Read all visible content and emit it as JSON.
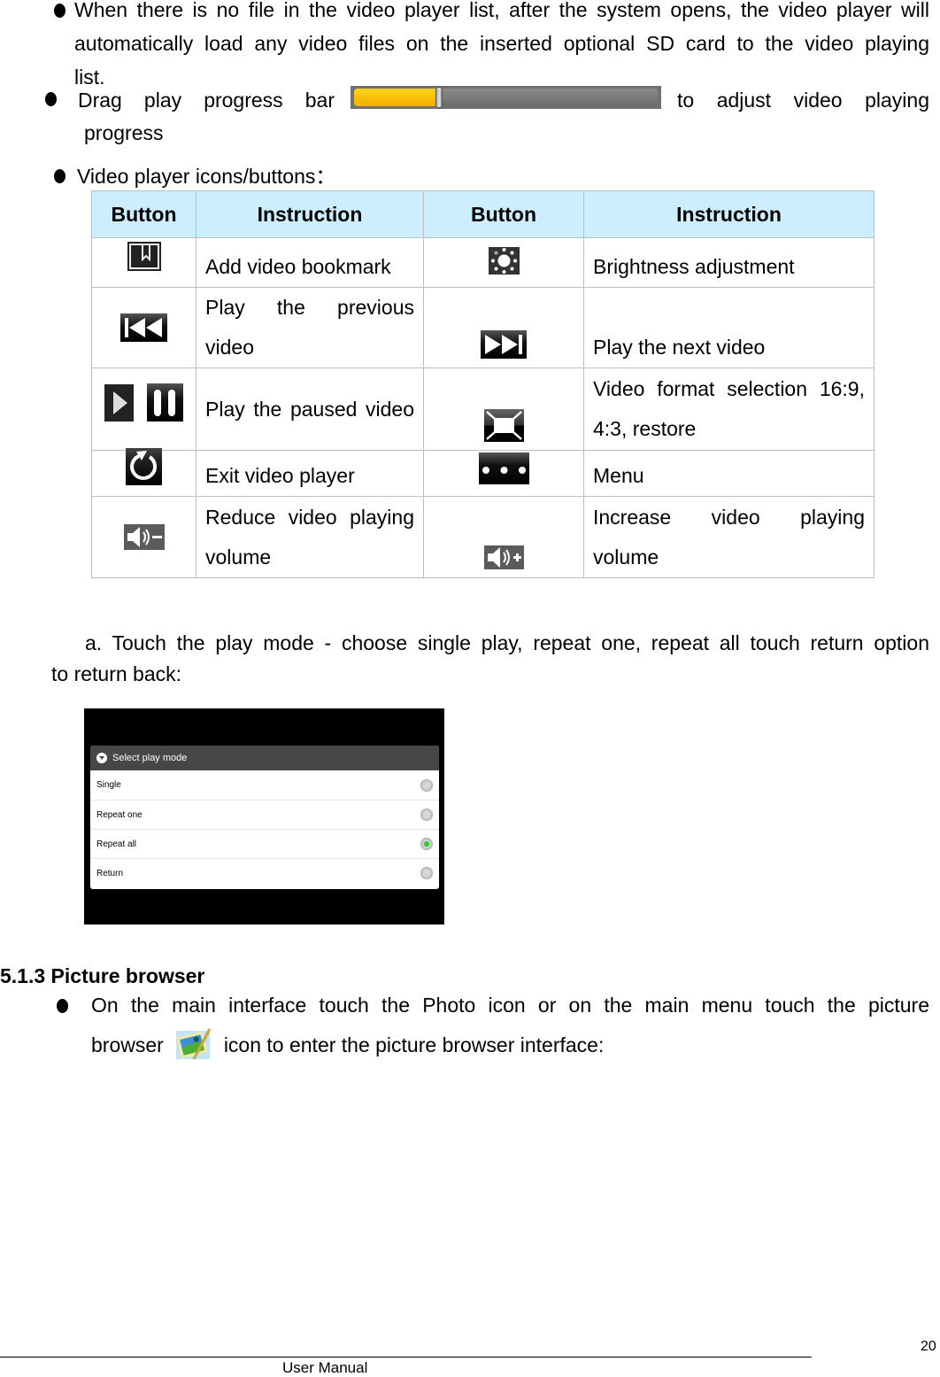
{
  "intro": {
    "bullet1": {
      "line1": "When there is no file in the video player list, after the system opens, the video player will",
      "line2": "automatically load any video files on the inserted optional SD card to the video playing",
      "line3": "list."
    },
    "bullet2": {
      "before": "Drag play progress bar",
      "after": "to adjust video playing",
      "line2": "progress",
      "progress_percent": 28,
      "progress_colors": {
        "fill": "#ffc400",
        "track": "#757575"
      }
    },
    "bullet3": "Video player icons/buttons："
  },
  "table": {
    "headers": [
      "Button",
      "Instruction",
      "Button",
      "Instruction"
    ],
    "rows": [
      {
        "left_icons": [
          "bookmark-icon"
        ],
        "left_text": "Add video bookmark",
        "right_icon": "brightness-icon",
        "right_text": "Brightness adjustment"
      },
      {
        "left_icons": [
          "previous-icon"
        ],
        "left_text": "Play the previous video",
        "right_icon": "next-icon",
        "right_text": "Play the next video"
      },
      {
        "left_icons": [
          "play-icon",
          "pause-icon"
        ],
        "left_text": "Play the paused video",
        "right_icon": "aspect-ratio-icon",
        "right_text": "Video format selection 16:9, 4:3, restore"
      },
      {
        "left_icons": [
          "exit-icon"
        ],
        "left_text": "Exit video player",
        "right_icon": "menu-icon",
        "right_text": "Menu"
      },
      {
        "left_icons": [
          "volume-down-icon"
        ],
        "left_text": "Reduce video playing volume",
        "right_icon": "volume-up-icon",
        "right_text": "Increase video playing volume"
      }
    ]
  },
  "step_a": {
    "line1": "a. Touch the play mode - choose single play, repeat one, repeat all touch return option",
    "line2": "to return back:"
  },
  "dialog": {
    "title": "Select play mode",
    "options": [
      {
        "label": "Single",
        "selected": false
      },
      {
        "label": "Repeat one",
        "selected": false
      },
      {
        "label": "Repeat all",
        "selected": true
      },
      {
        "label": "Return",
        "selected": false
      }
    ],
    "selected_color": "#1fd21f"
  },
  "section": {
    "heading": "5.1.3 Picture browser",
    "bullet_line1": "On the main interface touch the Photo icon or on the main menu touch the picture",
    "bullet_before_icon": "browser",
    "bullet_after_icon": "icon to enter the picture browser interface:"
  },
  "footer": {
    "page_number": "20",
    "label": "User Manual"
  }
}
